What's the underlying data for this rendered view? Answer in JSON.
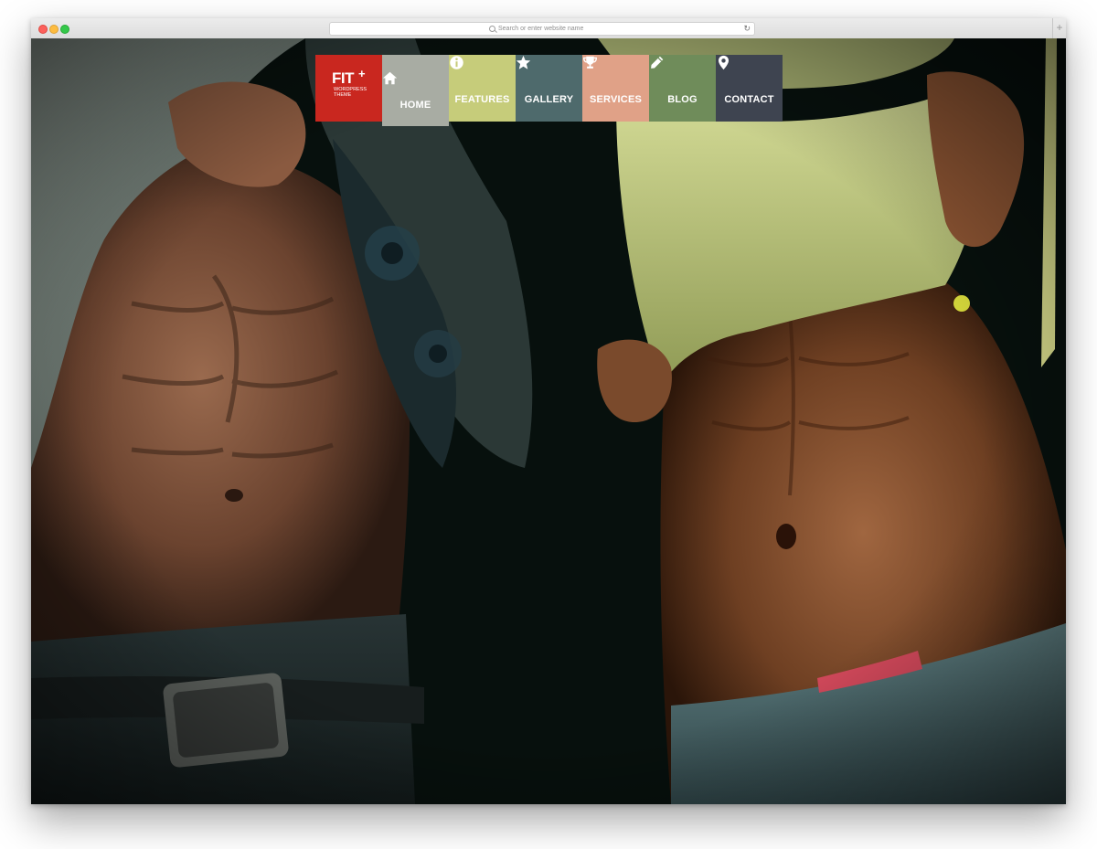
{
  "browser": {
    "url_placeholder": "Search or enter website name",
    "reload_icon": "reload-icon",
    "new_tab_icon": "plus-icon"
  },
  "logo": {
    "main": "FIT",
    "plus": "+",
    "subtitle": "WORDPRESS THEME"
  },
  "nav": {
    "items": [
      {
        "label": "HOME",
        "icon": "home-icon",
        "color": "#a8aca3",
        "active": true
      },
      {
        "label": "FEATURES",
        "icon": "info-icon",
        "color": "#c6cc7a"
      },
      {
        "label": "GALLERY",
        "icon": "star-icon",
        "color": "#4e6a6c"
      },
      {
        "label": "SERVICES",
        "icon": "trophy-icon",
        "color": "#e0a187"
      },
      {
        "label": "BLOG",
        "icon": "pencil-icon",
        "color": "#6f8c5a"
      },
      {
        "label": "CONTACT",
        "icon": "map-pin-icon",
        "color": "#3e4450"
      }
    ]
  },
  "colors": {
    "logo_bg": "#c9271f"
  }
}
